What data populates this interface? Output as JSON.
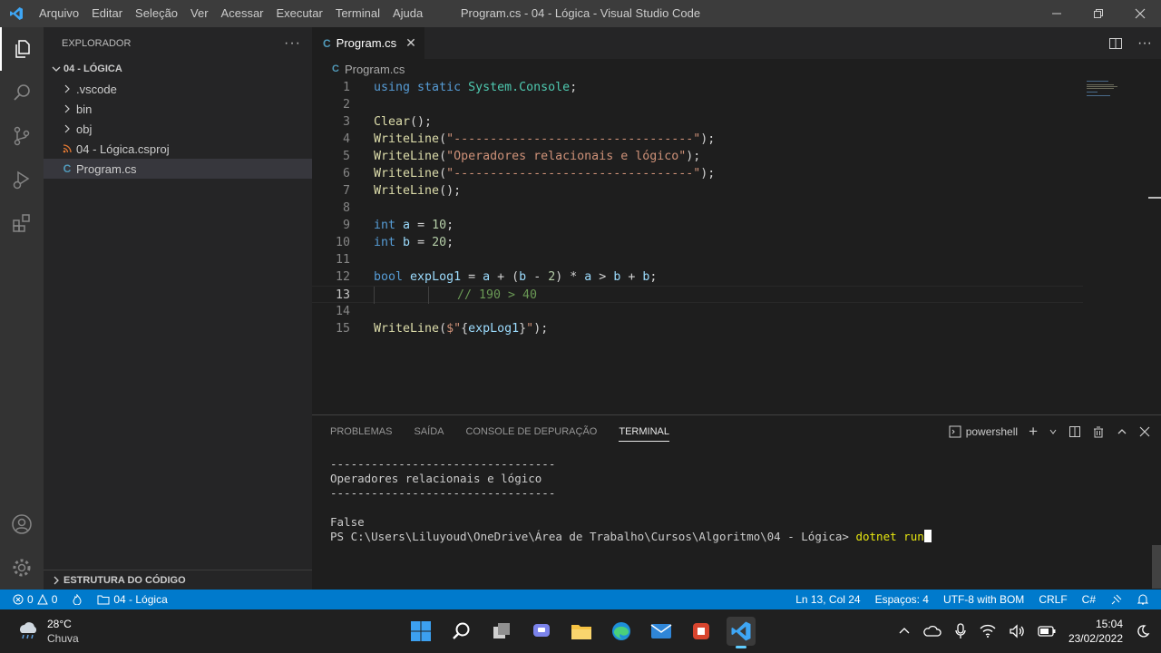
{
  "window": {
    "title": "Program.cs - 04 - Lógica - Visual Studio Code",
    "menu": [
      "Arquivo",
      "Editar",
      "Seleção",
      "Ver",
      "Acessar",
      "Executar",
      "Terminal",
      "Ajuda"
    ]
  },
  "sidebar": {
    "header": "EXPLORADOR",
    "folder": "04 - LÓGICA",
    "items": [
      {
        "label": ".vscode",
        "icon": "chevron-right-icon"
      },
      {
        "label": "bin",
        "icon": "chevron-right-icon"
      },
      {
        "label": "obj",
        "icon": "chevron-right-icon"
      },
      {
        "label": "04 - Lógica.csproj",
        "icon": "rss-icon"
      },
      {
        "label": "Program.cs",
        "icon": "csharp-file-icon"
      }
    ],
    "outline": "ESTRUTURA DO CÓDIGO"
  },
  "editor": {
    "tab_label": "Program.cs",
    "breadcrumb": "Program.cs",
    "current_line": 13,
    "lines": [
      {
        "n": "1"
      },
      {
        "n": "2"
      },
      {
        "n": "3"
      },
      {
        "n": "4"
      },
      {
        "n": "5"
      },
      {
        "n": "6"
      },
      {
        "n": "7"
      },
      {
        "n": "8"
      },
      {
        "n": "9"
      },
      {
        "n": "10"
      },
      {
        "n": "11"
      },
      {
        "n": "12"
      },
      {
        "n": "13"
      },
      {
        "n": "14"
      },
      {
        "n": "15"
      }
    ],
    "code": {
      "l1_using": "using",
      "l1_static": "static",
      "l1_ns": "System.Console",
      "l3_fn": "Clear",
      "l4_fn": "WriteLine",
      "l4_str": "\"---------------------------------\"",
      "l5_fn": "WriteLine",
      "l5_str": "\"Operadores relacionais e lógico\"",
      "l6_fn": "WriteLine",
      "l6_str": "\"---------------------------------\"",
      "l7_fn": "WriteLine",
      "l9_type": "int",
      "l9_var": "a",
      "l9_num": "10",
      "l10_type": "int",
      "l10_var": "b",
      "l10_num": "20",
      "l12_type": "bool",
      "l12_var": "expLog1",
      "l12_a1": "a",
      "l12_b1": "b",
      "l12_num": "2",
      "l12_a2": "a",
      "l12_b2": "b",
      "l12_b3": "b",
      "l13_comment": "// 190 > 40",
      "l15_fn": "WriteLine",
      "l15_str_open": "$\"",
      "l15_interp": "expLog1",
      "l15_str_close": "\""
    }
  },
  "panel": {
    "tabs": [
      "PROBLEMAS",
      "SAÍDA",
      "CONSOLE DE DEPURAÇÃO",
      "TERMINAL"
    ],
    "active_tab": "TERMINAL",
    "shell": "powershell",
    "terminal_lines": [
      "---------------------------------",
      "Operadores relacionais e lógico",
      "---------------------------------",
      "",
      "False"
    ],
    "prompt": "PS C:\\Users\\Liluyoud\\OneDrive\\Área de Trabalho\\Cursos\\Algoritmo\\04 - Lógica> ",
    "command": "dotnet run"
  },
  "statusbar": {
    "errors": "0",
    "warnings": "0",
    "folder": "04 - Lógica",
    "position": "Ln 13, Col 24",
    "spaces": "Espaços: 4",
    "encoding": "UTF-8 with BOM",
    "eol": "CRLF",
    "language": "C#"
  },
  "taskbar": {
    "temperature": "28°C",
    "condition": "Chuva",
    "time": "15:04",
    "date": "23/02/2022"
  },
  "colors": {
    "accent": "#007acc",
    "keyword": "#569cd6",
    "function": "#dcdcaa",
    "string": "#ce9178",
    "variable": "#9cdcfe",
    "number": "#b5cea8",
    "comment": "#6a9955"
  }
}
